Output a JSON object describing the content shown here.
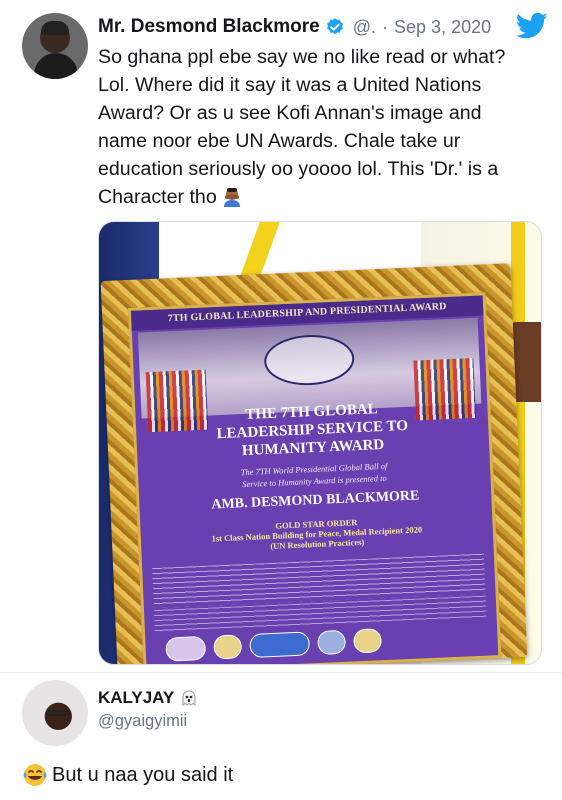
{
  "tweet": {
    "author_name": "Mr. Desmond Blackmore",
    "handle": "@.",
    "separator": "·",
    "date": "Sep 3, 2020",
    "text": "So ghana ppl ebe say we no like read or what?\nLol. Where did it say it was a United Nations\nAward? Or as u see Kofi Annan's image and\nname noor ebe UN Awards. Chale take ur\neducation seriously oo yoooo lol. This 'Dr.' is a\nCharacter tho",
    "emoji": "man-facepalming",
    "verified_icon": "verified-badge-icon",
    "brand_icon": "twitter-bird-icon"
  },
  "media": {
    "certificate": {
      "header": "7TH GLOBAL LEADERSHIP AND PRESIDENTIAL AWARD",
      "award_title": "THE 7TH GLOBAL\nLEADERSHIP SERVICE TO\nHUMANITY AWARD",
      "subtitle": "The 7TH World Presidential Global Ball of\nService to Humanity Award is presented to",
      "recipient": "AMB. DESMOND BLACKMORE",
      "order": "GOLD STAR ORDER\n1st Class Nation Building for Peace, Medal Recipient 2020\n(UN Resolution Practices)"
    }
  },
  "reply": {
    "author_name": "KALYJAY",
    "handle": "@gyaigyimii",
    "text": "But u naa you said it",
    "name_emoji": "ghost-icon",
    "text_emoji": "face-with-tears-of-joy-icon"
  },
  "colors": {
    "text_primary": "#14171a",
    "text_secondary": "#657786",
    "verified_blue": "#1da1f2",
    "divider": "#e6ecf0"
  }
}
